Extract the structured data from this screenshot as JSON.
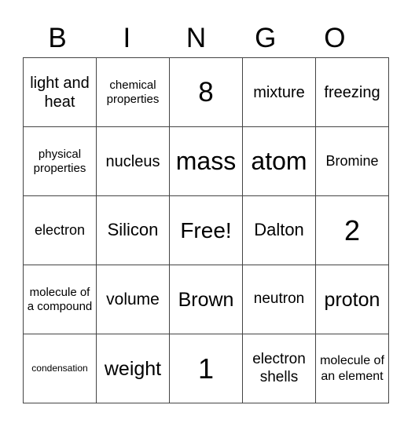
{
  "header": {
    "letters": [
      "B",
      "I",
      "N",
      "G",
      "O"
    ]
  },
  "card": {
    "rows": [
      [
        "light and heat",
        "chemical properties",
        "8",
        "mixture",
        "freezing"
      ],
      [
        "physical properties",
        "nucleus",
        "mass",
        "atom",
        "Bromine"
      ],
      [
        "electron",
        "Silicon",
        "Free!",
        "Dalton",
        "2"
      ],
      [
        "molecule of a compound",
        "volume",
        "Brown",
        "neutron",
        "proton"
      ],
      [
        "condensation",
        "weight",
        "1",
        "electron shells",
        "molecule of an element"
      ]
    ]
  }
}
